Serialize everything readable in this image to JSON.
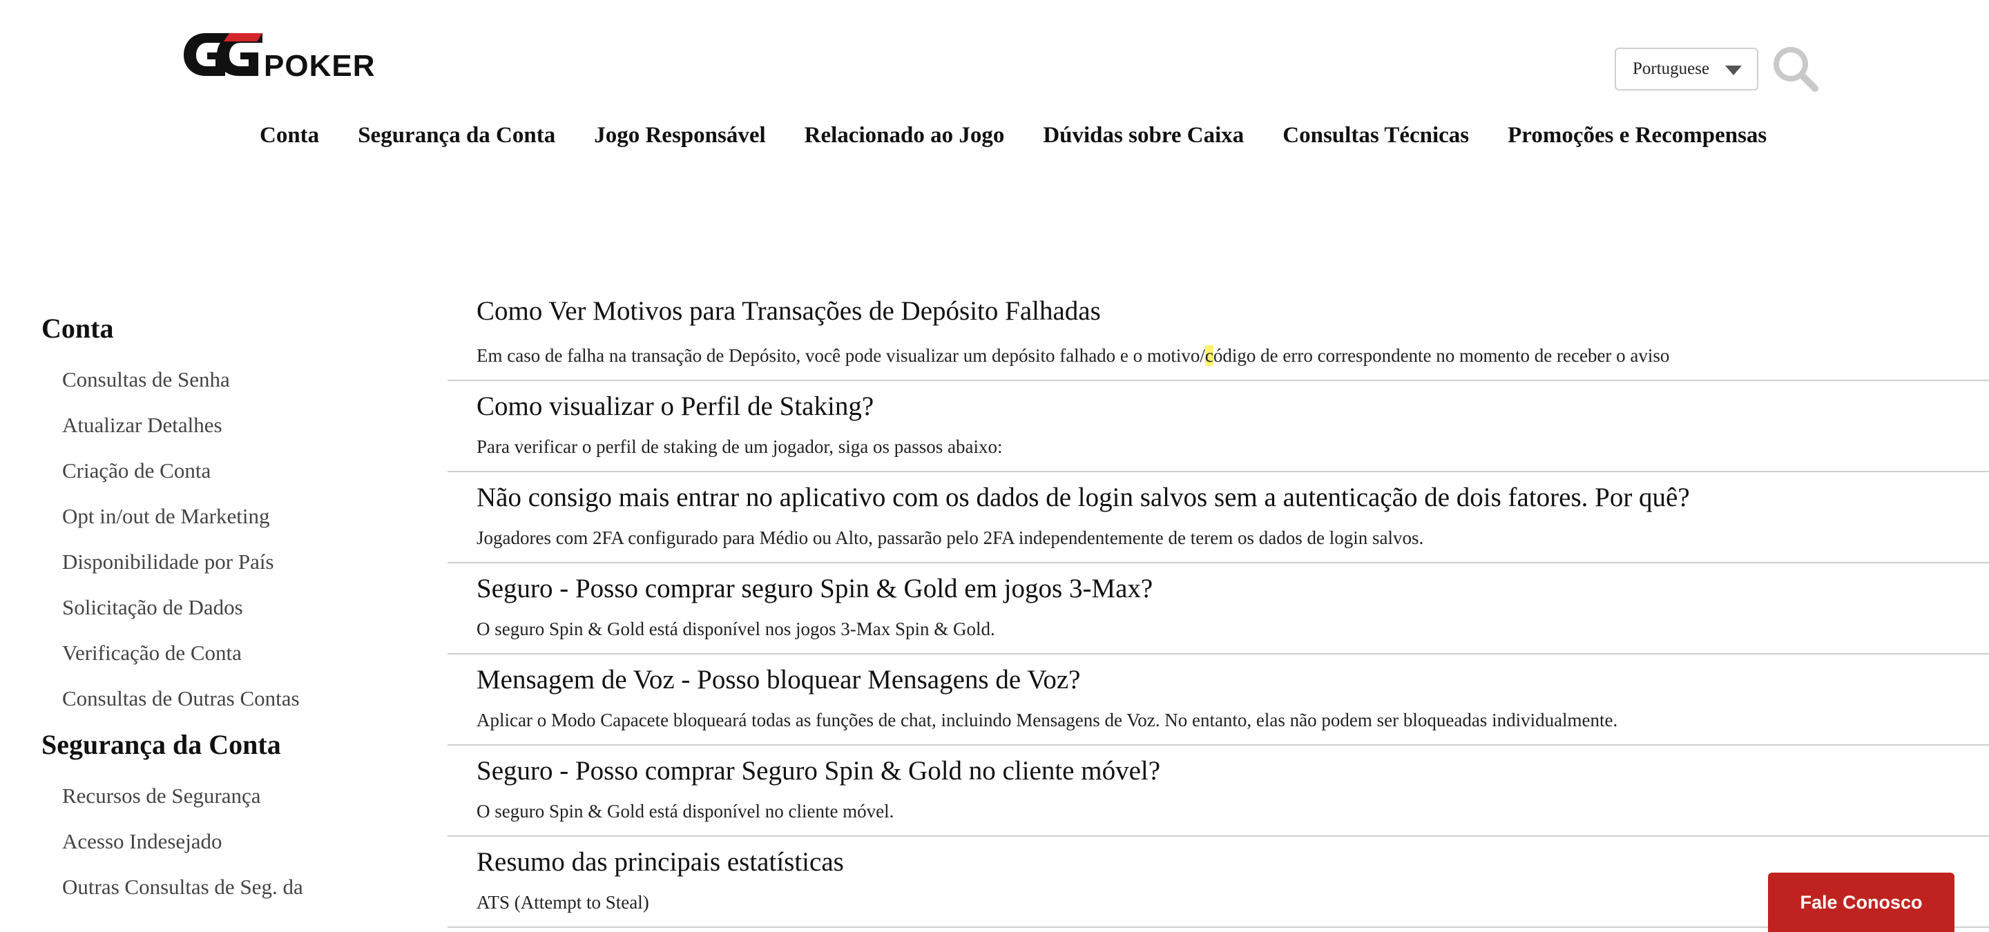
{
  "header": {
    "logo_text_gg": "GG",
    "logo_text_poker": "POKER",
    "language": "Portuguese",
    "search_icon": "search-icon"
  },
  "nav": [
    {
      "label": "Conta"
    },
    {
      "label": "Segurança da Conta"
    },
    {
      "label": "Jogo Responsável"
    },
    {
      "label": "Relacionado ao Jogo"
    },
    {
      "label": "Dúvidas sobre Caixa"
    },
    {
      "label": "Consultas Técnicas"
    },
    {
      "label": "Promoções e Recompensas"
    }
  ],
  "sidebar": {
    "sections": [
      {
        "title": "Conta",
        "items": [
          "Consultas de Senha",
          "Atualizar Detalhes",
          "Criação de Conta",
          "Opt in/out de Marketing",
          "Disponibilidade por País",
          "Solicitação de Dados",
          "Verificação de Conta",
          "Consultas de Outras Contas"
        ]
      },
      {
        "title": "Segurança da Conta",
        "items": [
          "Recursos de Segurança",
          "Acesso Indesejado",
          "Outras Consultas de Seg. da"
        ]
      }
    ]
  },
  "articles": [
    {
      "title": "Como Ver Motivos para Transações de Depósito Falhadas",
      "excerpt_pre": "Em caso de falha na transação de Depósito, você pode visualizar um depósito falhado e o motivo/",
      "excerpt_hl": "c",
      "excerpt_post": "ódigo de erro correspondente no momento de receber o aviso"
    },
    {
      "title": "Como visualizar o Perfil de Staking?",
      "excerpt": "Para verificar o perfil de staking de um jogador, siga os passos abaixo:"
    },
    {
      "title": "Não consigo mais entrar no aplicativo com os dados de login salvos sem a autenticação de dois fatores. Por quê?",
      "excerpt": "Jogadores com 2FA configurado para Médio ou Alto, passarão pelo 2FA independentemente de terem os dados de login salvos."
    },
    {
      "title": "Seguro - Posso comprar seguro Spin & Gold em jogos 3-Max?",
      "excerpt": "O seguro Spin & Gold está disponível nos jogos 3-Max Spin & Gold."
    },
    {
      "title": "Mensagem de Voz - Posso bloquear Mensagens de Voz?",
      "excerpt": "Aplicar o Modo Capacete bloqueará todas as funções de chat, incluindo Mensagens de Voz. No entanto, elas não podem ser bloqueadas individualmente."
    },
    {
      "title": "Seguro - Posso comprar Seguro Spin & Gold no cliente móvel?",
      "excerpt": "O seguro Spin & Gold está disponível no cliente móvel."
    },
    {
      "title": "Resumo das principais estatísticas",
      "excerpt": "ATS (Attempt to Steal)"
    }
  ],
  "contact_button": "Fale Conosco",
  "colors": {
    "accent": "#c0231f",
    "divider": "#cfcfcf",
    "highlight": "#fff36a"
  }
}
